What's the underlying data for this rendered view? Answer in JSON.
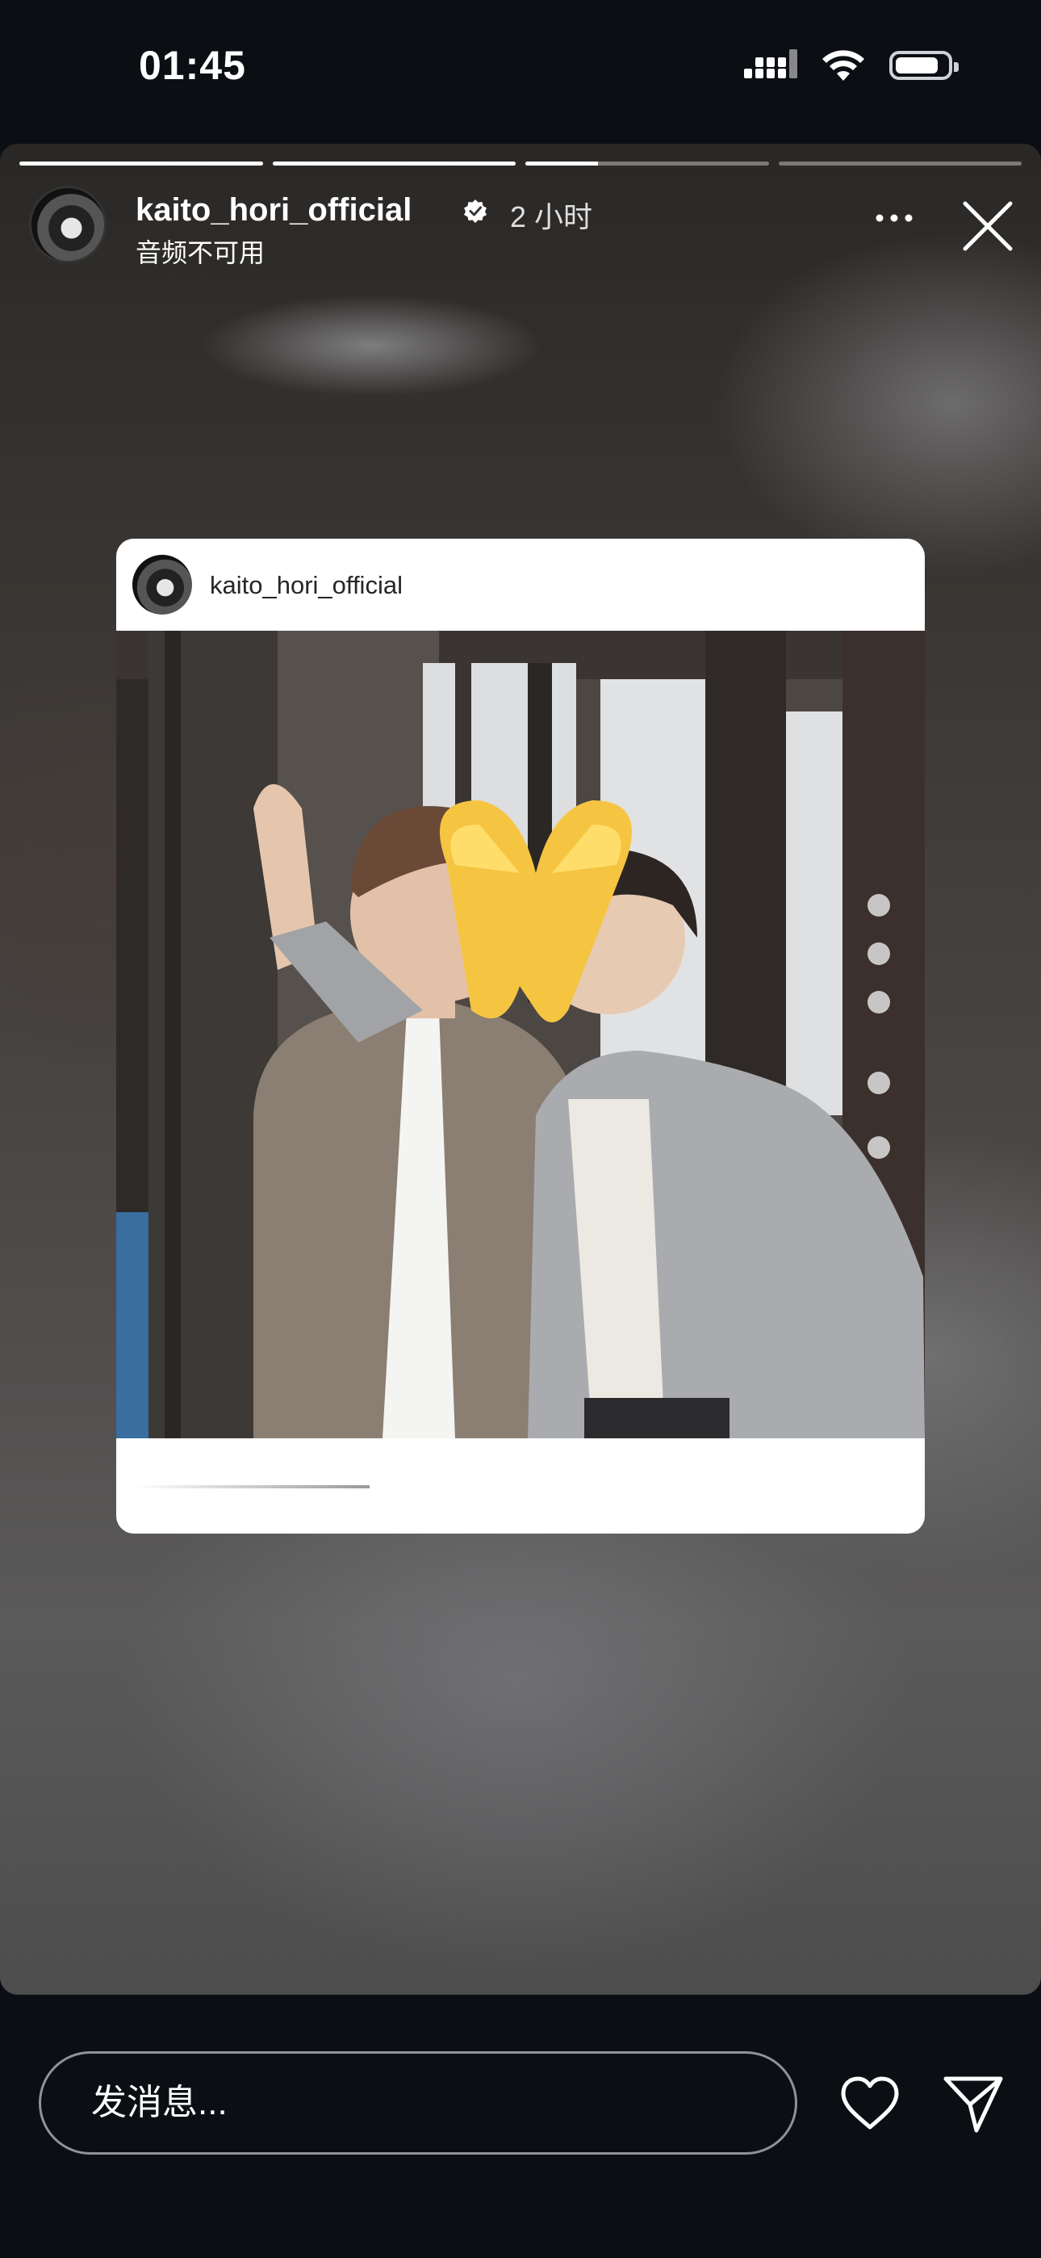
{
  "status_bar": {
    "time": "01:45",
    "icons": [
      "cellular-signal-icon",
      "wifi-icon",
      "battery-icon"
    ]
  },
  "story": {
    "progress": [
      1.0,
      1.0,
      0.3,
      0.0
    ],
    "header": {
      "username": "kaito_hori_official",
      "verified": true,
      "time_ago": "2 小时",
      "subtitle": "音频不可用"
    },
    "post_card": {
      "username": "kaito_hori_official"
    }
  },
  "bottom_bar": {
    "message_placeholder": "发消息..."
  },
  "colors": {
    "background": "#0b0f14",
    "text": "#ffffff",
    "verified": "#ffffff"
  }
}
